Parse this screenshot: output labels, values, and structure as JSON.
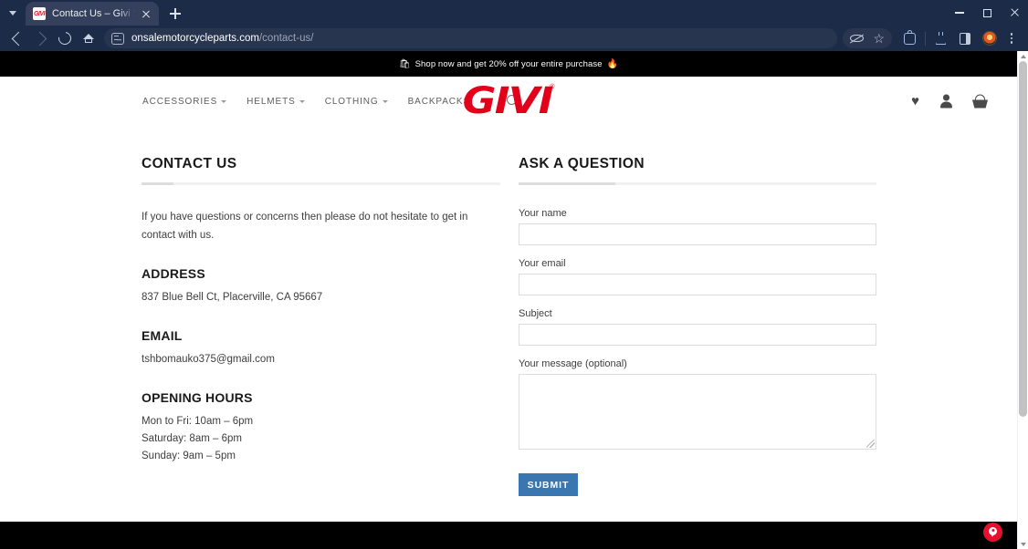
{
  "browser": {
    "tab": {
      "title": "Contact Us – Givi Sales Store – |",
      "favicon_label": "GIVI",
      "favicon_icon": "givi-logo-favicon",
      "close_icon": "close-icon"
    },
    "tab_list_icon": "chevron-down-icon",
    "new_tab_icon": "plus-icon",
    "window_controls": {
      "minimize_icon": "minimize-icon",
      "maximize_icon": "maximize-icon",
      "close_icon": "close-icon"
    },
    "toolbar": {
      "back_icon": "back-arrow-icon",
      "forward_icon": "forward-arrow-icon",
      "reload_icon": "reload-icon",
      "home_icon": "home-icon",
      "site_info_icon": "site-settings-icon",
      "url_domain": "onsalemotorcycleparts.com",
      "url_path": "/contact-us/",
      "tracking_protection_icon": "eye-slash-icon",
      "bookmark_icon": "star-icon",
      "extensions_icon": "extensions-puzzle-icon",
      "experiments_icon": "flask-icon",
      "side_panel_icon": "split-panel-icon",
      "profile_icon": "avatar-icon",
      "menu_icon": "kebab-menu-icon"
    },
    "scrollbar": {
      "up_icon": "scroll-up-arrow-icon",
      "down_icon": "scroll-down-arrow-icon"
    }
  },
  "page": {
    "promo": {
      "left_emoji": "🛍",
      "text": "Shop now and get 20% off your entire purchase",
      "right_emoji": "🔥"
    },
    "header": {
      "nav": [
        {
          "label": "ACCESSORIES",
          "has_dropdown": true
        },
        {
          "label": "HELMETS",
          "has_dropdown": true
        },
        {
          "label": "CLOTHING",
          "has_dropdown": true
        },
        {
          "label": "BACKPACKS",
          "has_dropdown": false
        }
      ],
      "search_icon": "search-icon",
      "logo": {
        "text": "GIVI",
        "trademark": "®",
        "color": "#e2001a"
      },
      "icons": [
        {
          "name": "wishlist-heart-icon",
          "glyph": "♥"
        },
        {
          "name": "account-user-icon"
        },
        {
          "name": "cart-basket-icon"
        }
      ]
    },
    "contact": {
      "title": "CONTACT US",
      "intro": "If you have questions or concerns then please do not hesitate to get in contact with us.",
      "address_title": "ADDRESS",
      "address": "837 Blue Bell Ct, Placerville, CA 95667",
      "email_title": "EMAIL",
      "email": "tshbomauko375@gmail.com",
      "hours_title": "OPENING HOURS",
      "hours": [
        "Mon to Fri: 10am – 6pm",
        "Saturday: 8am – 6pm",
        "Sunday: 9am – 5pm"
      ]
    },
    "form": {
      "title": "ASK A QUESTION",
      "fields": {
        "name_label": "Your name",
        "name_value": "",
        "email_label": "Your email",
        "email_value": "",
        "subject_label": "Subject",
        "subject_value": "",
        "message_label": "Your message (optional)",
        "message_value": ""
      },
      "submit_label": "SUBMIT",
      "submit_color": "#3a76b0"
    },
    "floating_widget": {
      "name": "location-pin-badge",
      "color": "#e8112d"
    }
  }
}
